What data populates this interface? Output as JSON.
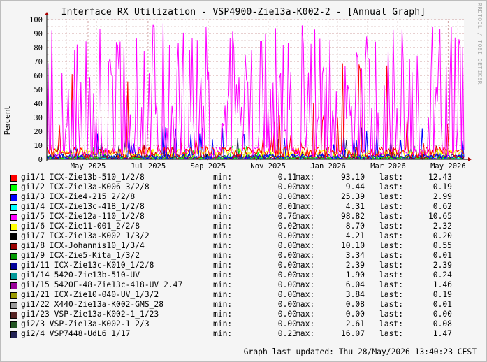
{
  "title": "Interface RX Utilization - VSP4900-Zie13a-K002-2 - [Annual Graph]",
  "watermark": "RRDTOOL / TOBI OETIKER",
  "labels": {
    "min": "min:",
    "max": "max:",
    "last": "last:"
  },
  "updated": "Graph last updated: Thu 28/May/2026 13:40:23 CEST",
  "chart_data": {
    "type": "line",
    "ylabel": "Percent",
    "ylim": [
      0,
      100
    ],
    "yticks": [
      "0",
      "10",
      "20",
      "30",
      "40",
      "50",
      "60",
      "70",
      "80",
      "90",
      "100"
    ],
    "xticks": [
      "May 2025",
      "Jul 2025",
      "Sep 2025",
      "Nov 2025",
      "Jan 2026",
      "Mar 2026",
      "May 2026"
    ],
    "grid": true,
    "legend_position": "bottom",
    "series": [
      {
        "name": "gi1/1 ICX-Zie13b-510_1/2/8",
        "color": "#ff0000",
        "min": "0.11",
        "max": "93.10",
        "last": "12.43"
      },
      {
        "name": "gi1/2 ICX-Zie13a-K006_3/2/8",
        "color": "#00ff00",
        "min": "0.00",
        "max": "9.44",
        "last": "0.19"
      },
      {
        "name": "gi1/3 ICX-Zie4-215_2/2/8",
        "color": "#0000ff",
        "min": "0.00",
        "max": "25.39",
        "last": "2.99"
      },
      {
        "name": "gi1/4 ICX-Zie13c-418_1/2/8",
        "color": "#00ffff",
        "min": "0.01",
        "max": "4.31",
        "last": "0.62"
      },
      {
        "name": "gi1/5 ICX-Zie12a-110_1/2/8",
        "color": "#ff00ff",
        "min": "0.76",
        "max": "98.82",
        "last": "10.65"
      },
      {
        "name": "gi1/6 ICX-Zie11-001_2/2/8",
        "color": "#ffff00",
        "min": "0.02",
        "max": "8.70",
        "last": "2.32"
      },
      {
        "name": "gi1/7 ICX-Zie13a-K002_1/3/2",
        "color": "#000000",
        "min": "0.00",
        "max": "4.21",
        "last": "0.20"
      },
      {
        "name": "gi1/8 ICX-Johannis10_1/3/4",
        "color": "#990000",
        "min": "0.00",
        "max": "10.10",
        "last": "0.55"
      },
      {
        "name": "gi1/9 ICX-Zie5-Kita_1/3/2",
        "color": "#009900",
        "min": "0.00",
        "max": "3.34",
        "last": "0.01"
      },
      {
        "name": "gi1/11 ICX-Zie13c-K010_1/2/8",
        "color": "#000099",
        "min": "0.00",
        "max": "2.39",
        "last": "2.39"
      },
      {
        "name": "gi1/14 5420-Zie13b-510-UV",
        "color": "#009999",
        "min": "0.00",
        "max": "1.90",
        "last": "0.24"
      },
      {
        "name": "gi1/15 5420F-48-Zie13c-418-UV_2.47",
        "color": "#990099",
        "min": "0.00",
        "max": "6.04",
        "last": "1.46"
      },
      {
        "name": "gi1/21 ICX-Zie10-040-UV_1/3/2",
        "color": "#999900",
        "min": "0.00",
        "max": "3.84",
        "last": "0.19"
      },
      {
        "name": "gi1/22 X440-Zie13a-K002-GMS_28",
        "color": "#999999",
        "min": "0.00",
        "max": "0.08",
        "last": "0.01"
      },
      {
        "name": "gi1/23 VSP-Zie13a-K002-1_1/23",
        "color": "#552222",
        "min": "0.00",
        "max": "0.00",
        "last": "0.00"
      },
      {
        "name": "gi2/3 VSP-Zie13a-K002-1_2/3",
        "color": "#225522",
        "min": "0.00",
        "max": "2.61",
        "last": "0.08"
      },
      {
        "name": "gi2/4 VSP7448-UdL6_1/17",
        "color": "#222255",
        "min": "0.23",
        "max": "16.07",
        "last": "1.47"
      }
    ]
  }
}
